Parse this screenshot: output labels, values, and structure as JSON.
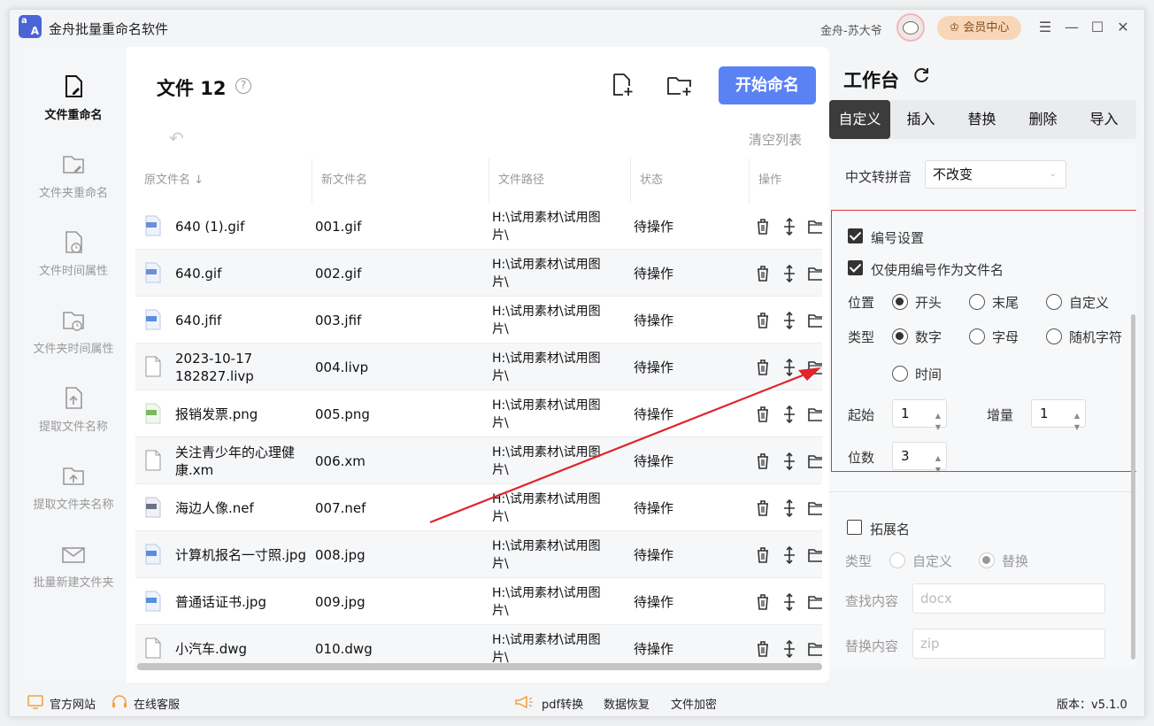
{
  "app": {
    "title": "金舟批量重命名软件",
    "logo_letters": [
      "a",
      "A"
    ],
    "username": "金舟-苏大爷",
    "vip_label": "会员中心",
    "window_controls": [
      "☰",
      "—",
      "☐",
      "✕"
    ]
  },
  "nav": {
    "items": [
      {
        "label": "文件重命名",
        "icon": "file-edit-icon",
        "active": true
      },
      {
        "label": "文件夹重命名",
        "icon": "folder-edit-icon",
        "active": false
      },
      {
        "label": "文件时间属性",
        "icon": "file-clock-icon",
        "active": false
      },
      {
        "label": "文件夹时间属性",
        "icon": "folder-clock-icon",
        "active": false
      },
      {
        "label": "提取文件名称",
        "icon": "file-upload-icon",
        "active": false
      },
      {
        "label": "提取文件夹名称",
        "icon": "folder-upload-icon",
        "active": false
      },
      {
        "label": "批量新建文件夹",
        "icon": "mail-folder-icon",
        "active": false
      }
    ]
  },
  "list": {
    "title": "文件 12",
    "help": "?",
    "start_button": "开始命名",
    "clear_list": "清空列表",
    "undo": "↶",
    "columns": [
      "原文件名 ↓",
      "新文件名",
      "文件路径",
      "状态",
      "操作"
    ],
    "rows": [
      {
        "original": "640 (1).gif",
        "new": "001.gif",
        "path": "H:\\试用素材\\试用图片\\",
        "status": "待操作",
        "icon": "gif-file-icon"
      },
      {
        "original": "640.gif",
        "new": "002.gif",
        "path": "H:\\试用素材\\试用图片\\",
        "status": "待操作",
        "icon": "gif-file-icon"
      },
      {
        "original": "640.jfif",
        "new": "003.jfif",
        "path": "H:\\试用素材\\试用图片\\",
        "status": "待操作",
        "icon": "jpg-file-icon"
      },
      {
        "original": "2023-10-17 182827.livp",
        "new": "004.livp",
        "path": "H:\\试用素材\\试用图片\\",
        "status": "待操作",
        "icon": "blank-file-icon"
      },
      {
        "original": "报销发票.png",
        "new": "005.png",
        "path": "H:\\试用素材\\试用图片\\",
        "status": "待操作",
        "icon": "png-file-icon"
      },
      {
        "original": "关注青少年的心理健康.xm",
        "new": "006.xm",
        "path": "H:\\试用素材\\试用图片\\",
        "status": "待操作",
        "icon": "blank-file-icon"
      },
      {
        "original": "海边人像.nef",
        "new": "007.nef",
        "path": "H:\\试用素材\\试用图片\\",
        "status": "待操作",
        "icon": "nef-file-icon"
      },
      {
        "original": "计算机报名一寸照.jpg",
        "new": "008.jpg",
        "path": "H:\\试用素材\\试用图片\\",
        "status": "待操作",
        "icon": "jpg-file-icon"
      },
      {
        "original": "普通话证书.jpg",
        "new": "009.jpg",
        "path": "H:\\试用素材\\试用图片\\",
        "status": "待操作",
        "icon": "jpg-file-icon"
      },
      {
        "original": "小汽车.dwg",
        "new": "010.dwg",
        "path": "H:\\试用素材\\试用图片\\",
        "status": "待操作",
        "icon": "blank-file-icon"
      }
    ]
  },
  "workspace": {
    "title": "工作台",
    "tabs": [
      "自定义",
      "插入",
      "替换",
      "删除",
      "导入"
    ],
    "active_tab": 0,
    "pinyin_label": "中文转拼音",
    "pinyin_value": "不改变",
    "numbering": {
      "enable_label": "编号设置",
      "enabled": true,
      "only_number_label": "仅使用编号作为文件名",
      "only_number": true,
      "position_label": "位置",
      "position_options": [
        "开头",
        "末尾",
        "自定义"
      ],
      "position_selected": 0,
      "type_label": "类型",
      "type_options": [
        "数字",
        "字母",
        "随机字符",
        "时间"
      ],
      "type_selected": 0,
      "start_label": "起始",
      "start_value": "1",
      "increment_label": "增量",
      "increment_value": "1",
      "digits_label": "位数",
      "digits_value": "3"
    },
    "extension": {
      "enable_label": "拓展名",
      "enabled": false,
      "type_label": "类型",
      "type_options": [
        "自定义",
        "替换"
      ],
      "type_selected": 1,
      "find_label": "查找内容",
      "find_placeholder": "docx",
      "replace_label": "替换内容",
      "replace_placeholder": "zip"
    }
  },
  "footer": {
    "website": "官方网站",
    "support": "在线客服",
    "pdf": "pdf转换",
    "recovery": "数据恢复",
    "encrypt": "文件加密",
    "version": "版本：v5.1.0"
  },
  "colors": {
    "accent": "#5a82f5",
    "vip_bg": "#f7d7b8",
    "highlight_border": "#d9363e",
    "annotation_arrow": "#e0242b"
  }
}
